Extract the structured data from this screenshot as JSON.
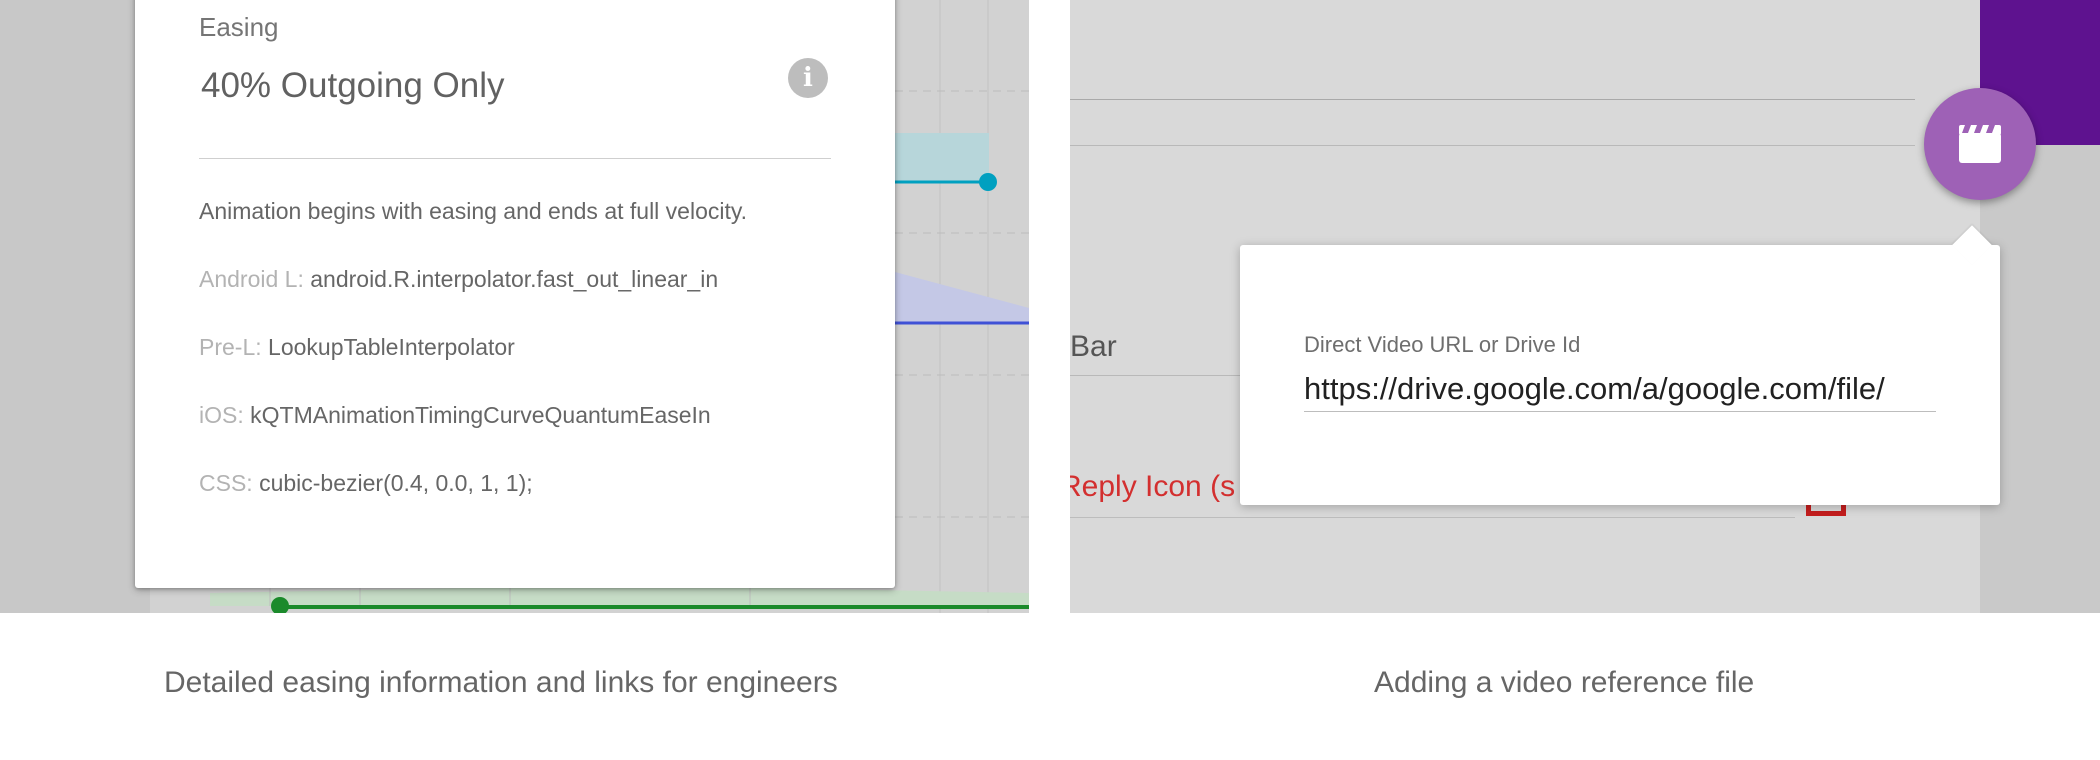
{
  "left": {
    "card": {
      "small_label": "Easing",
      "title": "40% Outgoing Only",
      "description": "Animation begins with easing and ends at full velocity.",
      "rows": [
        {
          "key": "Android L:",
          "value": "android.R.interpolator.fast_out_linear_in"
        },
        {
          "key": "Pre-L:",
          "value": "LookupTableInterpolator"
        },
        {
          "key": "iOS:",
          "value": "kQTMAnimationTimingCurveQuantumEaseIn"
        },
        {
          "key": "CSS:",
          "value": "cubic-bezier(0.4, 0.0, 1, 1);"
        }
      ],
      "info_icon": "info-icon"
    },
    "caption": "Detailed easing information and links for engineers"
  },
  "right": {
    "bar_text": "Bar",
    "reply_text": "Reply Icon (s",
    "fab_icon": "video-clapper-icon",
    "popup": {
      "label": "Direct Video URL or Drive Id",
      "value": "https://drive.google.com/a/google.com/file/"
    },
    "caption": "Adding a video reference file"
  },
  "colors": {
    "purple_accent": "#5e128f",
    "fab": "#9e61b6",
    "teal_track": "#00a0c0",
    "blue_track": "#3f51d6",
    "green_track": "#1b8a2b",
    "red_text": "#d32f2f"
  }
}
